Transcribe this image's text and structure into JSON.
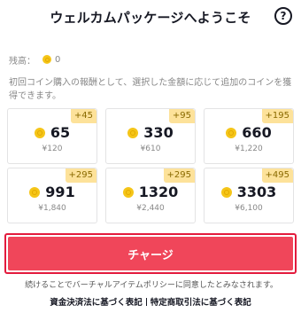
{
  "header": {
    "title": "ウェルカムパッケージへようこそ",
    "help_icon": "?"
  },
  "balance": {
    "label": "残高：",
    "value": "0"
  },
  "description": "初回コイン購入の報酬として、選択した金額に応じて追加のコインを獲得できます。",
  "packages": [
    {
      "bonus": "+45",
      "coins": "65",
      "price": "¥120"
    },
    {
      "bonus": "+95",
      "coins": "330",
      "price": "¥610"
    },
    {
      "bonus": "+195",
      "coins": "660",
      "price": "¥1,220"
    },
    {
      "bonus": "+295",
      "coins": "991",
      "price": "¥1,840"
    },
    {
      "bonus": "+295",
      "coins": "1320",
      "price": "¥2,440"
    },
    {
      "bonus": "+495",
      "coins": "3303",
      "price": "¥6,100"
    }
  ],
  "charge_label": "チャージ",
  "policy_text": "続けることでバーチャルアイテムポリシーに同意したとみなされます。",
  "footer": {
    "link1": "資金決済法に基づく表記",
    "link2": "特定商取引法に基づく表記"
  },
  "colors": {
    "accent": "#f0465a",
    "accent_border": "#e31b3d",
    "bonus_bg": "#fde29a",
    "coin": "#f5c518"
  }
}
